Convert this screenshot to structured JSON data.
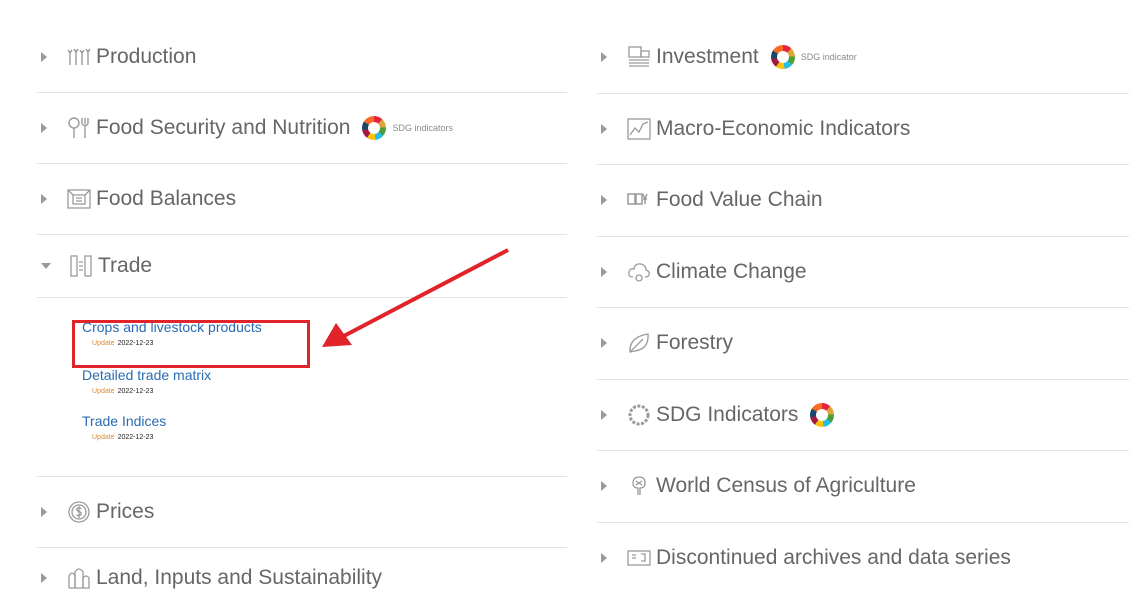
{
  "left": {
    "items": [
      {
        "label": "Production",
        "icon": "wheat-icon"
      },
      {
        "label": "Food Security and Nutrition",
        "icon": "cutlery-icon",
        "sdg": "SDG indicators"
      },
      {
        "label": "Food Balances",
        "icon": "balance-sheet-icon"
      },
      {
        "label": "Trade",
        "icon": "trade-icon",
        "expanded": true
      },
      {
        "label": "Prices",
        "icon": "dollar-coin-icon"
      },
      {
        "label": "Land, Inputs and Sustainability",
        "icon": "land-icon"
      }
    ],
    "trade_sub": [
      {
        "label": "Crops and livestock products",
        "update_label": "Update",
        "date": "2022-12-23"
      },
      {
        "label": "Detailed trade matrix",
        "update_label": "Update",
        "date": "2022-12-23"
      },
      {
        "label": "Trade Indices",
        "update_label": "Update",
        "date": "2022-12-23"
      }
    ]
  },
  "right": {
    "items": [
      {
        "label": "Investment",
        "icon": "investment-icon",
        "sdg": "SDG indicator"
      },
      {
        "label": "Macro-Economic Indicators",
        "icon": "line-chart-icon"
      },
      {
        "label": "Food Value Chain",
        "icon": "value-chain-icon"
      },
      {
        "label": "Climate Change",
        "icon": "cloud-icon"
      },
      {
        "label": "Forestry",
        "icon": "leaf-icon"
      },
      {
        "label": "SDG Indicators",
        "icon": "sdg-wheel-icon",
        "sdg_ring": true
      },
      {
        "label": "World Census of Agriculture",
        "icon": "census-icon"
      },
      {
        "label": "Discontinued archives and data series",
        "icon": "archive-icon"
      }
    ]
  },
  "colors": {
    "link": "#2b6cb0",
    "update": "#e58a2b",
    "highlight": "#e0242a",
    "text": "#666666"
  }
}
